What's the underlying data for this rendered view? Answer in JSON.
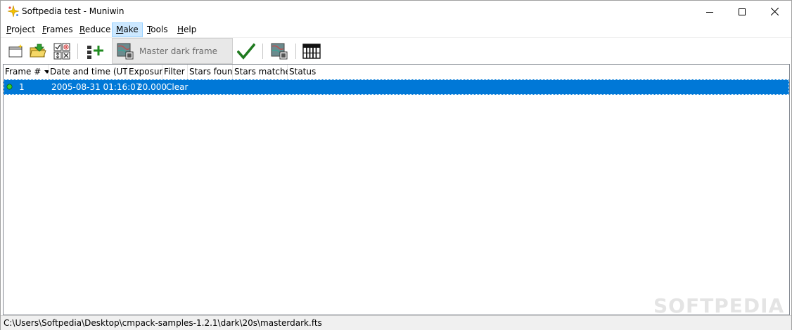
{
  "window": {
    "title": "Softpedia test - Muniwin"
  },
  "menu": {
    "items": [
      {
        "label": "Project",
        "mnemonic": "P"
      },
      {
        "label": "Frames",
        "mnemonic": "F"
      },
      {
        "label": "Reduce",
        "mnemonic": "R"
      },
      {
        "label": "Make",
        "mnemonic": "M"
      },
      {
        "label": "Tools",
        "mnemonic": "T"
      },
      {
        "label": "Help",
        "mnemonic": "H"
      }
    ],
    "active": "Make"
  },
  "toolbar": {
    "master_dark_label": "Master dark frame",
    "buttons": [
      "new-project-icon",
      "open-folder-icon",
      "select-options-icon",
      "add-frames-icon",
      "master-dark-icon",
      "checkmark-icon",
      "master-flat-icon",
      "table-grid-icon"
    ]
  },
  "frames_table": {
    "columns": [
      "Frame #",
      "Date and time (UTC)",
      "Exposure",
      "Filter",
      "Stars found",
      "Stars matched",
      "Status"
    ],
    "sorted_column": "Frame #",
    "rows": [
      {
        "frame": "1",
        "datetime": "2005-08-31 01:16:07",
        "exposure": "20.000",
        "filter": "Clear",
        "stars_found": "",
        "stars_matched": "",
        "status": ""
      }
    ]
  },
  "statusbar": {
    "path": "C:\\Users\\Softpedia\\Desktop\\cmpack-samples-1.2.1\\dark\\20s\\masterdark.fts"
  },
  "watermark": "SOFTPEDIA",
  "colors": {
    "selection": "#0078d7",
    "menu_highlight": "#cce8ff",
    "check_green": "#1f7a1f"
  }
}
